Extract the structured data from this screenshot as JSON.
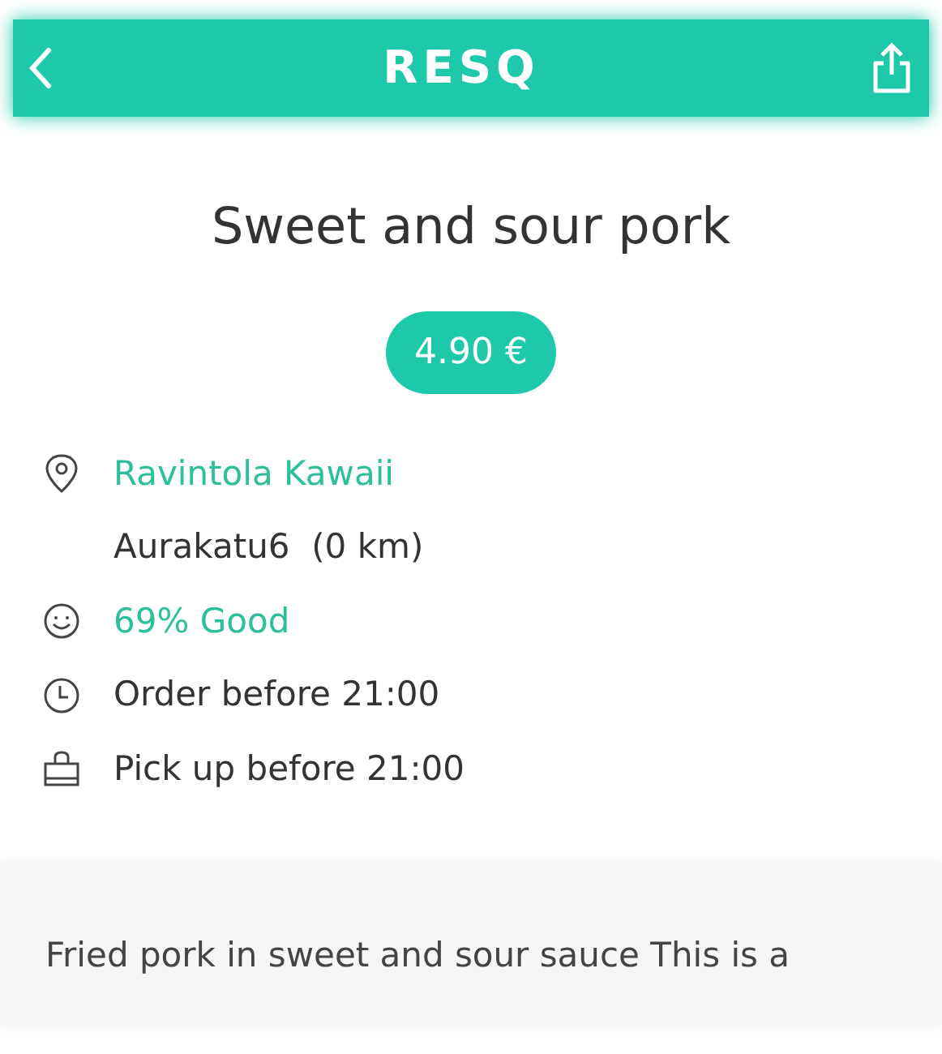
{
  "header": {
    "title": "RESQ"
  },
  "product": {
    "name": "Sweet and sour pork",
    "price": "4.90 €"
  },
  "details": [
    {
      "kind": "location",
      "text": "Ravintola Kawaii",
      "subtext": "Aurakatu6  (0 km)",
      "highlight": true
    },
    {
      "kind": "rating",
      "text": "69% Good",
      "highlight": true
    },
    {
      "kind": "clock",
      "text": "Order before 21:00",
      "highlight": false
    },
    {
      "kind": "bag",
      "text": "Pick up before 21:00",
      "highlight": false
    }
  ],
  "description": "Fried pork in sweet and sour sauce This is a"
}
